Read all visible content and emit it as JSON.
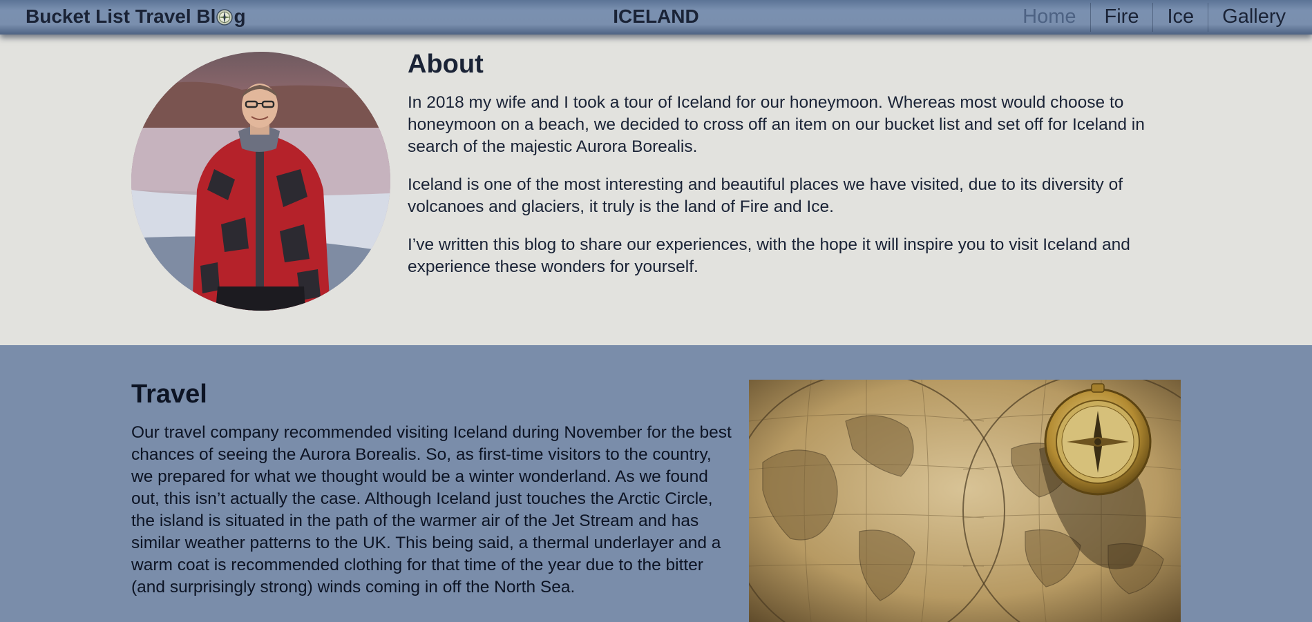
{
  "navbar": {
    "brand_before": "Bucket List Travel Bl",
    "brand_icon": "compass-icon",
    "brand_after": "g",
    "site_title": "ICELAND",
    "links": [
      {
        "label": "Home",
        "active": true
      },
      {
        "label": "Fire",
        "active": false
      },
      {
        "label": "Ice",
        "active": false
      },
      {
        "label": "Gallery",
        "active": false
      }
    ]
  },
  "about": {
    "heading": "About",
    "paragraphs": [
      "In 2018 my wife and I took a tour of Iceland for our honeymoon. Whereas most would choose to honeymoon on a beach, we decided to cross off an item on our bucket list and set off for Iceland in search of the majestic Aurora Borealis.",
      "Iceland is one of the most interesting and beautiful places we have visited, due to its diversity of volcanoes and glaciers, it truly is the land of Fire and Ice.",
      "I’ve written this blog to share our experiences, with the hope it will inspire you to visit Iceland and experience these wonders for yourself."
    ]
  },
  "travel": {
    "heading": "Travel",
    "paragraph": "Our travel company recommended visiting Iceland during November for the best chances of seeing the Aurora Borealis. So, as first-time visitors to the country, we prepared for what we thought would be a winter wonderland. As we found out, this isn’t actually the case. Although Iceland just touches the Arctic Circle, the island is situated in the path of the warmer air of the Jet Stream and has similar weather patterns to the UK. This being said, a thermal underlayer and a warm coat is recommended clothing for that time of the year due to the bitter (and surprisingly strong) winds coming in off the North Sea."
  },
  "colors": {
    "nav_bg": "#7a8fae",
    "about_bg": "#e2e2de",
    "travel_bg": "#7a8daa",
    "text_dark": "#1a2336",
    "active_link": "#4d6283"
  }
}
